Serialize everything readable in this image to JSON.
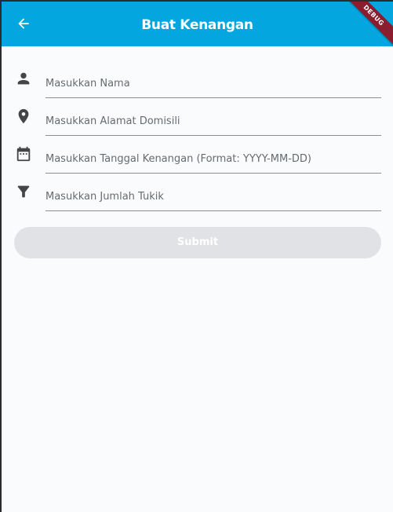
{
  "appbar": {
    "title": "Buat Kenangan",
    "back_icon": "arrow-back-icon",
    "background": "#03a6df"
  },
  "debug_banner": {
    "label": "DEBUG",
    "color": "#8a1d2e"
  },
  "form": {
    "fields": [
      {
        "icon": "person-icon",
        "placeholder": "Masukkan Nama",
        "value": ""
      },
      {
        "icon": "location-pin-icon",
        "placeholder": "Masukkan Alamat Domisili",
        "value": ""
      },
      {
        "icon": "calendar-icon",
        "placeholder": "Masukkan Tanggal Kenangan (Format: YYYY-MM-DD)",
        "value": ""
      },
      {
        "icon": "filter-icon",
        "placeholder": "Masukkan Jumlah Tukik",
        "value": ""
      }
    ],
    "submit_label": "Submit",
    "submit_enabled": false
  }
}
